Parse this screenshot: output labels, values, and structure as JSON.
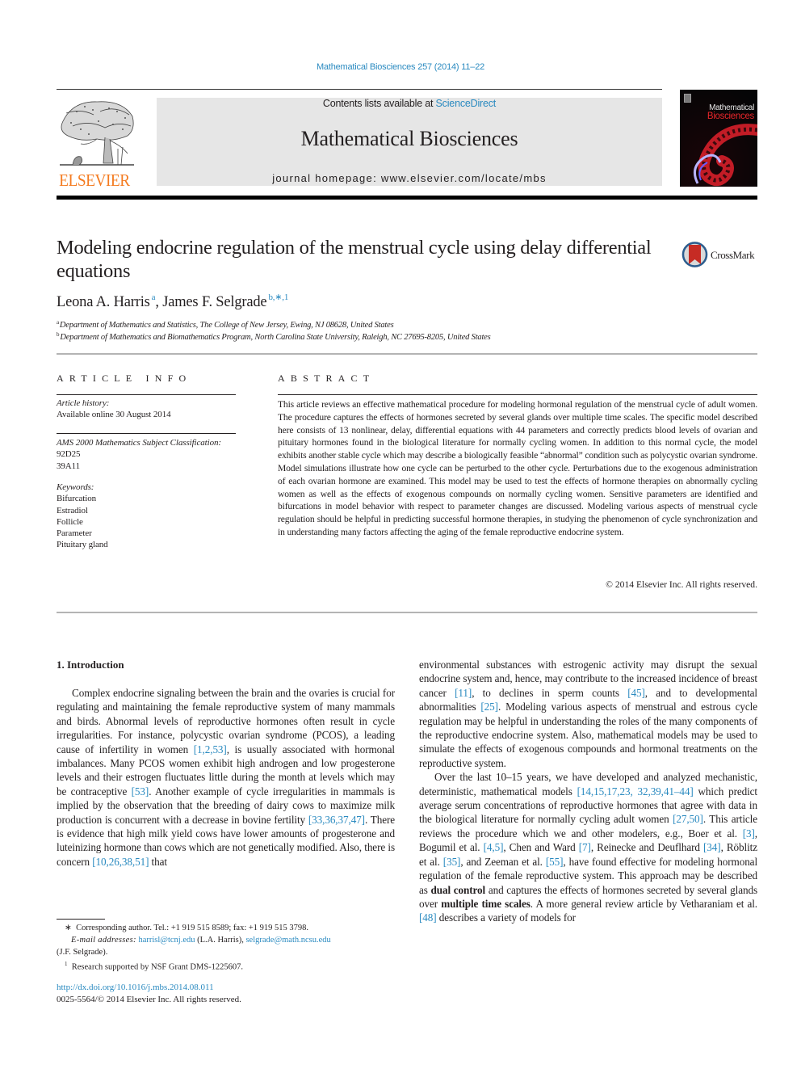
{
  "journal_ref": "Mathematical Biosciences 257 (2014) 11–22",
  "header": {
    "publisher_logo_text": "ELSEVIER",
    "contents_prefix": "Contents lists available at ",
    "contents_link": "ScienceDirect",
    "journal_name": "Mathematical Biosciences",
    "homepage": "journal homepage: www.elsevier.com/locate/mbs",
    "cover_title_line1": "Mathematical",
    "cover_title_line2": "Biosciences"
  },
  "colors": {
    "link": "#2a8ac0",
    "elsevier_orange": "#f47b20",
    "header_box": "#e6e6e6",
    "rule_gray": "#b4b4b4"
  },
  "article": {
    "title": "Modeling endocrine regulation of the menstrual cycle using delay differential equations",
    "crossmark_label": "CrossMark",
    "authors": [
      {
        "name": "Leona A. Harris",
        "marks": "a"
      },
      {
        "name": "James F. Selgrade",
        "marks": "b,∗,1"
      }
    ],
    "author_separator": ", ",
    "affiliations": [
      {
        "mark": "a",
        "text": "Department of Mathematics and Statistics, The College of New Jersey, Ewing, NJ 08628, United States"
      },
      {
        "mark": "b",
        "text": "Department of Mathematics and Biomathematics Program, North Carolina State University, Raleigh, NC 27695-8205, United States"
      }
    ]
  },
  "article_info": {
    "heading": "ARTICLE INFO",
    "history_label": "Article history:",
    "history_value": "Available online 30 August 2014",
    "ams_label": "AMS 2000 Mathematics Subject Classification:",
    "ams_codes": [
      "92D25",
      "39A11"
    ],
    "keywords_label": "Keywords:",
    "keywords": [
      "Bifurcation",
      "Estradiol",
      "Follicle",
      "Parameter",
      "Pituitary gland"
    ]
  },
  "abstract": {
    "heading": "ABSTRACT",
    "body": "This article reviews an effective mathematical procedure for modeling hormonal regulation of the menstrual cycle of adult women. The procedure captures the effects of hormones secreted by several glands over multiple time scales. The specific model described here consists of 13 nonlinear, delay, differential equations with 44 parameters and correctly predicts blood levels of ovarian and pituitary hormones found in the biological literature for normally cycling women. In addition to this normal cycle, the model exhibits another stable cycle which may describe a biologically feasible “abnormal” condition such as polycystic ovarian syndrome. Model simulations illustrate how one cycle can be perturbed to the other cycle. Perturbations due to the exogenous administration of each ovarian hormone are examined. This model may be used to test the effects of hormone therapies on abnormally cycling women as well as the effects of exogenous compounds on normally cycling women. Sensitive parameters are identified and bifurcations in model behavior with respect to parameter changes are discussed. Modeling various aspects of menstrual cycle regulation should be helpful in predicting successful hormone therapies, in studying the phenomenon of cycle synchronization and in understanding many factors affecting the aging of the female reproductive endocrine system.",
    "copyright": "© 2014 Elsevier Inc. All rights reserved."
  },
  "intro": {
    "heading": "1. Introduction",
    "left": {
      "p1_a": "Complex endocrine signaling between the brain and the ovaries is crucial for regulating and maintaining the female reproductive system of many mammals and birds. Abnormal levels of reproductive hormones often result in cycle irregularities. For instance, polycystic ovarian syndrome (PCOS), a leading cause of infertility in women ",
      "ref1": "[1,2,53]",
      "p1_b": ", is usually associated with hormonal imbalances. Many PCOS women exhibit high androgen and low progesterone levels and their estrogen fluctuates little during the month at levels which may be contraceptive ",
      "ref2": "[53]",
      "p1_c": ". Another example of cycle irregularities in mammals is implied by the observation that the breeding of dairy cows to maximize milk production is concurrent with a decrease in bovine fertility ",
      "ref3": "[33,36,37,47]",
      "p1_d": ". There is evidence that high milk yield cows have lower amounts of progesterone and luteinizing hormone than cows which are not genetically modified. Also, there is concern ",
      "ref4": "[10,26,38,51]",
      "p1_e": " that"
    },
    "right": {
      "p0_a": "environmental substances with estrogenic activity may disrupt the sexual endocrine system and, hence, may contribute to the increased incidence of breast cancer ",
      "ref1": "[11]",
      "p0_b": ", to declines in sperm counts ",
      "ref2": "[45]",
      "p0_c": ", and to developmental abnormalities ",
      "ref3": "[25]",
      "p0_d": ". Modeling various aspects of menstrual and estrous cycle regulation may be helpful in understanding the roles of the many components of the reproductive endocrine system. Also, mathematical models may be used to simulate the effects of exogenous compounds and hormonal treatments on the reproductive system.",
      "p2_a": "Over the last 10–15 years, we have developed and analyzed mechanistic, deterministic, mathematical models ",
      "ref4": "[14,15,17,23, 32,39,41–44]",
      "p2_b": " which predict average serum concentrations of reproductive hormones that agree with data in the biological literature for normally cycling adult women ",
      "ref5": "[27,50]",
      "p2_c": ". This article reviews the procedure which we and other modelers, e.g., Boer et al. ",
      "ref6": "[3]",
      "p2_d": ", Bogumil et al. ",
      "ref7": "[4,5]",
      "p2_e": ", Chen and Ward ",
      "ref8": "[7]",
      "p2_f": ", Reinecke and Deuflhard ",
      "ref9": "[34]",
      "p2_g": ", Röblitz et al. ",
      "ref10": "[35]",
      "p2_h": ", and Zeeman et al. ",
      "ref11": "[55]",
      "p2_i": ", have found effective for modeling hormonal regulation of the female reproductive system. This approach may be described as ",
      "bold1": "dual control",
      "p2_j": " and captures the effects of hormones secreted by several glands over ",
      "bold2": "multiple time scales",
      "p2_k": ". A more general review article by Vetharaniam et al. ",
      "ref12": "[48]",
      "p2_l": " describes a variety of models for"
    }
  },
  "footnotes": {
    "corresponding_mark": "∗",
    "corresponding": "Corresponding author. Tel.: +1 919 515 8589; fax: +1 919 515 3798.",
    "email_label": "E-mail addresses:",
    "email1": "harrisl@tcnj.edu",
    "email1_owner": " (L.A. Harris), ",
    "email2": "selgrade@math.ncsu.edu",
    "email2_owner": "(J.F. Selgrade).",
    "funding_mark": "1",
    "funding": "Research supported by NSF Grant DMS-1225607."
  },
  "doi": "http://dx.doi.org/10.1016/j.mbs.2014.08.011",
  "issn": "0025-5564/© 2014 Elsevier Inc. All rights reserved."
}
